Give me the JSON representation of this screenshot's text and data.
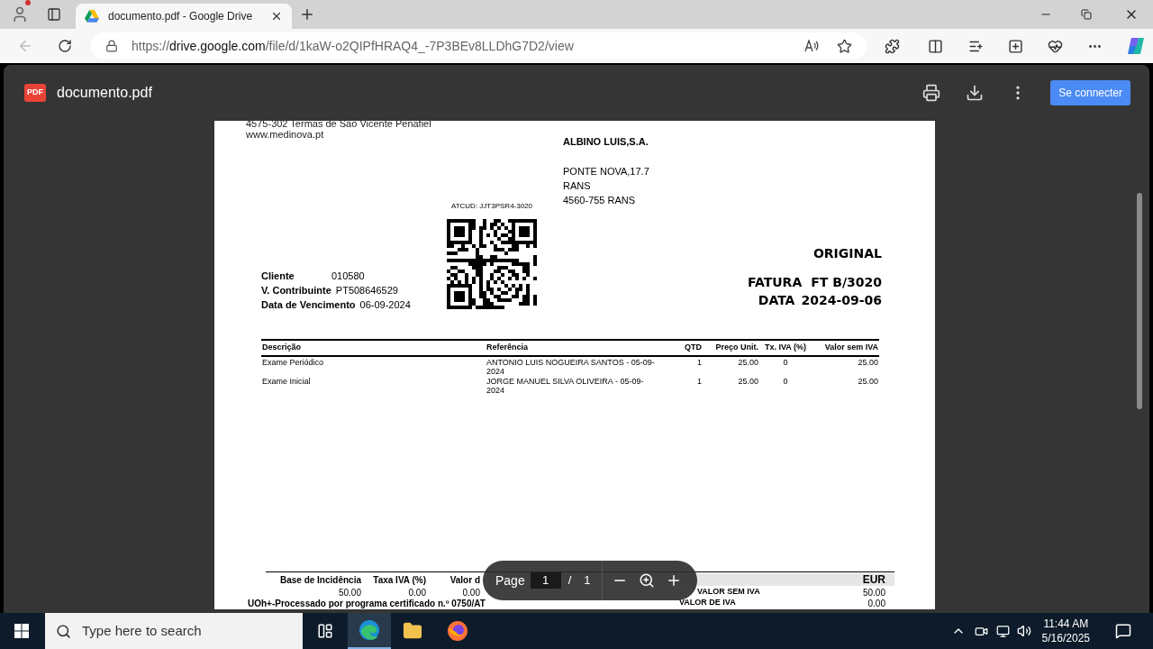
{
  "browser": {
    "tab": {
      "title": "documento.pdf - Google Drive",
      "selected": true
    },
    "url": {
      "scheme": "https://",
      "host": "drive.google.com",
      "path": "/file/d/1kaW-o2QIPfHRAQ4_-7P3BEv8LLDhG7D2/view"
    },
    "back_disabled": true
  },
  "viewer": {
    "file_name": "documento.pdf",
    "file_badge": "PDF",
    "connect_button": "Se connecter"
  },
  "document": {
    "sender_lines": [
      "4575-302 Termas de São Vicente Penafiel",
      "www.medinova.pt"
    ],
    "recipient": {
      "name": "ALBINO LUIS,S.A.",
      "lines": [
        "PONTE NOVA,17.7",
        "RANS",
        "4560-755 RANS"
      ]
    },
    "atcud": "ATCUD: JJT3PSR4-3020",
    "client_fields": [
      {
        "label": "Cliente",
        "value": "010580"
      },
      {
        "label": "V. Contribuinte",
        "value": "PT508646529"
      },
      {
        "label": "Data de Vencimento",
        "value": "06-09-2024"
      }
    ],
    "copy_label": "ORIGINAL",
    "invoice": {
      "type_label": "FATURA",
      "number": "FT B/3020",
      "date_label": "DATA",
      "date": "2024-09-06"
    },
    "table": {
      "columns": [
        "Descrição",
        "Referência",
        "QTD",
        "Preço Unit.",
        "Tx. IVA (%)",
        "Valor sem IVA"
      ],
      "rows": [
        [
          "Exame Periódico",
          "ANTONIO LUIS NOGUEIRA SANTOS - 05-09-2024",
          "1",
          "25.00",
          "0",
          "25.00"
        ],
        [
          "Exame Inicial",
          "JORGE MANUEL SILVA OLIVEIRA  - 05-09-2024",
          "1",
          "25.00",
          "0",
          "25.00"
        ]
      ]
    },
    "totals": {
      "columns": [
        "Base de Incidência",
        "Taxa IVA (%)",
        "Valor d"
      ],
      "row": [
        "50.00",
        "0.00",
        "0.00"
      ],
      "currency": "EUR",
      "summary": [
        {
          "label": "VALOR SEM IVA",
          "value": "50.00"
        },
        {
          "label": "VALOR DE IVA",
          "value": "0.00"
        }
      ],
      "footer": "UOh+-Processado por programa certificado n.º 0750/AT"
    }
  },
  "page_toolbar": {
    "page_label": "Page",
    "page": "1",
    "separator": "/",
    "total": "1"
  },
  "taskbar": {
    "search_placeholder": "Type here to search",
    "time": "11:44 AM",
    "date": "5/16/2025"
  }
}
